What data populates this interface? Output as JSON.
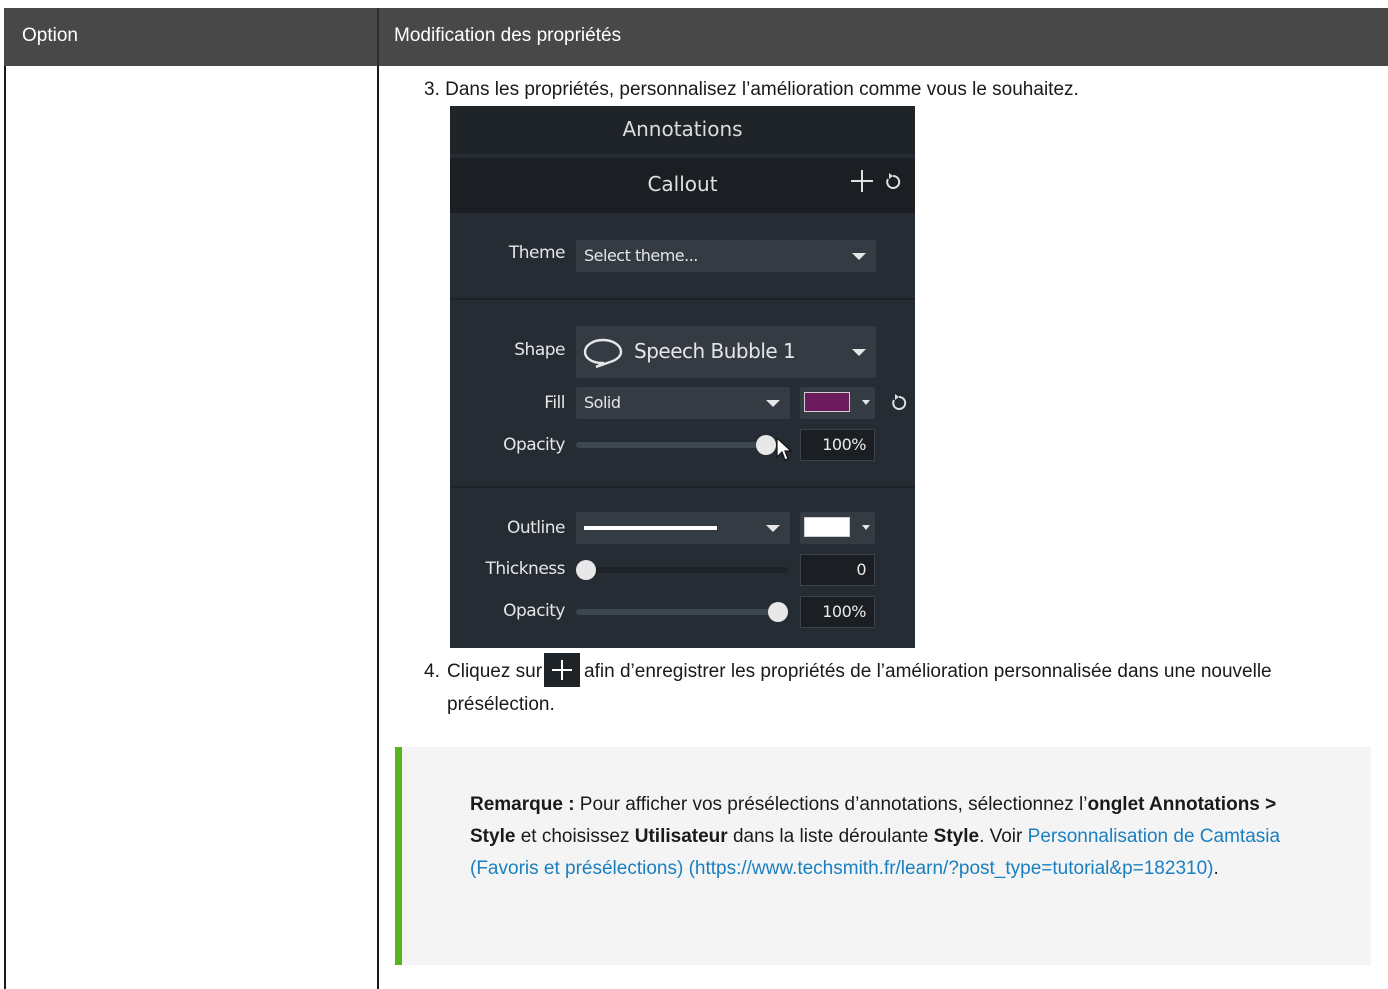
{
  "table": {
    "header": {
      "option": "Option",
      "modification": "Modification des propriétés"
    }
  },
  "steps": {
    "step3_num": "3.",
    "step3_text": "Dans les propriétés, personnalisez l’amélioration comme vous le souhaitez.",
    "step4_num": "4.",
    "step4_before": "Cliquez sur",
    "step4_after": "afin d’enregistrer les propriétés de l’amélioration personnalisée dans une nouvelle présélection."
  },
  "panel": {
    "title": "Annotations",
    "subtitle": "Callout",
    "theme_label": "Theme",
    "theme_value": "Select theme...",
    "shape_label": "Shape",
    "shape_value": "Speech Bubble 1",
    "fill_label": "Fill",
    "fill_value": "Solid",
    "fill_color": "#6b1a5c",
    "opacity_label": "Opacity",
    "opacity_value": "100%",
    "opacity_level": 1.0,
    "outline_label": "Outline",
    "outline_color": "#ffffff",
    "thickness_label": "Thickness",
    "thickness_value": "0",
    "thickness_level": 0.0,
    "outline_opacity_label": "Opacity",
    "outline_opacity_value": "100%",
    "outline_opacity_level": 1.0
  },
  "note": {
    "label": "Remarque :",
    "t1": " Pour afficher vos présélections d’annotations, sélectionnez l’",
    "b1": "onglet Annotations > Style",
    "t2": " et choisissez ",
    "b2": "Utilisateur",
    "t3": " dans la liste déroulante ",
    "b3": "Style",
    "t4": ". Voir ",
    "link": "Personnalisation de Camtasia (Favoris et présélections) (https://www.techsmith.fr/learn/?post_type=tutorial&p=182310)",
    "t5": "."
  },
  "colors": {
    "header_bg": "#484848",
    "note_accent": "#5ab31e",
    "link": "#1a7fc1",
    "panel_bg": "#262c33"
  },
  "icons": [
    "plus-icon",
    "reset-icon",
    "speech-bubble-icon",
    "chevron-down-icon",
    "cursor-icon"
  ]
}
